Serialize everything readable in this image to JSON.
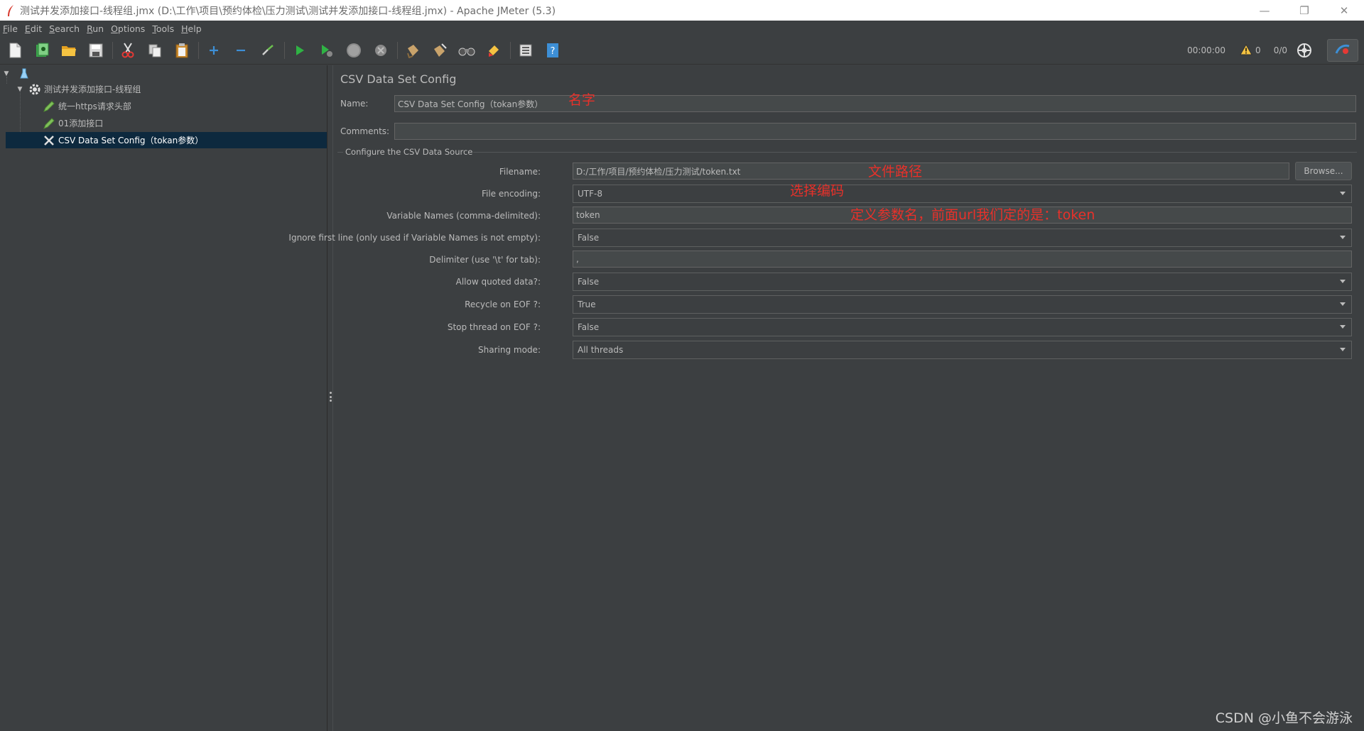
{
  "window": {
    "title": "测试并发添加接口-线程组.jmx (D:\\工作\\项目\\预约体检\\压力测试\\测试并发添加接口-线程组.jmx) - Apache JMeter (5.3)",
    "minimize_glyph": "—",
    "restore_glyph": "❐",
    "close_glyph": "✕"
  },
  "menu": [
    "File",
    "Edit",
    "Search",
    "Run",
    "Options",
    "Tools",
    "Help"
  ],
  "toolbar": {
    "timer": "00:00:00",
    "warning_count": "0",
    "threads": "0/0"
  },
  "tree": {
    "root_label": "",
    "thread_group": "测试并发添加接口-线程组",
    "header_manager": "统一https请求头部",
    "http_sampler": "01添加接口",
    "csv_config": "CSV Data Set Config（tokan参数）"
  },
  "panel": {
    "title": "CSV Data Set Config",
    "name_label": "Name:",
    "name_value": "CSV Data Set Config（tokan参数）",
    "comments_label": "Comments:",
    "comments_value": "",
    "group_title": "Configure the CSV Data Source",
    "filename_label": "Filename:",
    "filename_value": "D:/工作/项目/预约体检/压力测试/token.txt",
    "browse_label": "Browse...",
    "encoding_label": "File encoding:",
    "encoding_value": "UTF-8",
    "varnames_label": "Variable Names (comma-delimited):",
    "varnames_value": "token",
    "ignore_label": "Ignore first line (only used if Variable Names is not empty):",
    "ignore_value": "False",
    "delimiter_label": "Delimiter (use '\\t' for tab):",
    "delimiter_value": ",",
    "quoted_label": "Allow quoted data?:",
    "quoted_value": "False",
    "recycle_label": "Recycle on EOF ?:",
    "recycle_value": "True",
    "stop_label": "Stop thread on EOF ?:",
    "stop_value": "False",
    "sharing_label": "Sharing mode:",
    "sharing_value": "All threads"
  },
  "annotations": {
    "name_note": "名字",
    "path_note": "文件路径",
    "encoding_note": "选择编码",
    "param_note": "定义参数名，前面url我们定的是：token"
  },
  "watermark": "CSDN @小鱼不会游泳",
  "colors": {
    "background": "#3c3f41",
    "selection": "#0d293e",
    "annotation": "#e8312a",
    "text": "#bbbbbb"
  }
}
